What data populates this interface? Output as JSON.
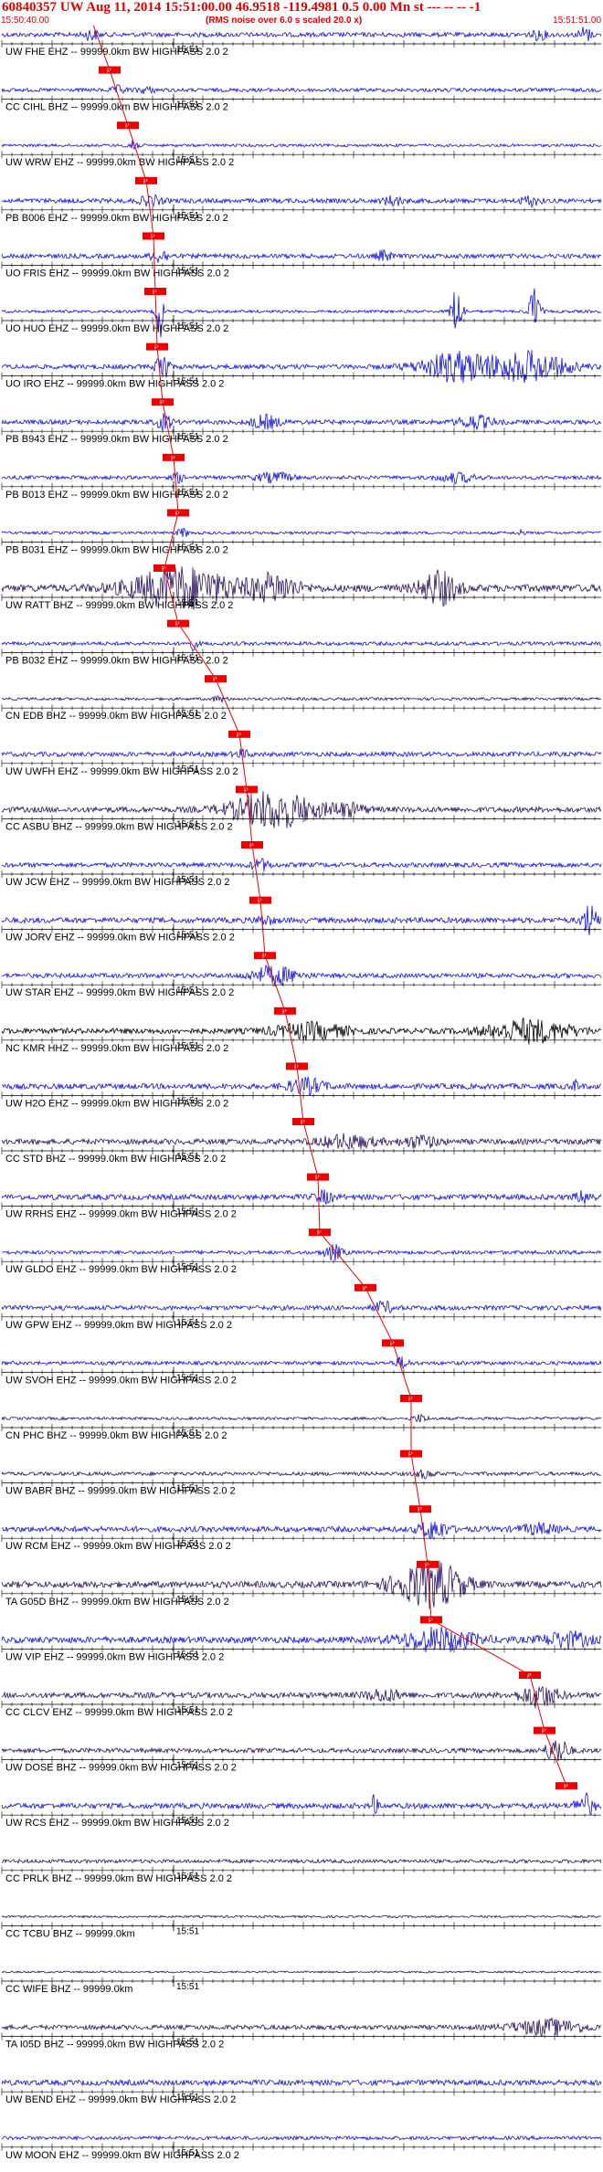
{
  "header": {
    "title": "60840357 UW Aug 11, 2014 15:51:00.00   46.9518 -119.4981  0.5 0.00 Mn st --- -- --  -1",
    "start_time": "15:50:40.00",
    "note": "(RMS noise over 6.0 s scaled 20.0 x)",
    "end_time": "15:51:51.00"
  },
  "tick_label": "15:51",
  "pick_label": "P",
  "colors": {
    "trace": "#1010e0",
    "trace_dark": "#2a1060",
    "trace_black": "#000000",
    "pick": "#ee0000",
    "accent": "#e00000"
  },
  "traces": [
    {
      "label": "UW FHE EHZ -- 99999.0km BW  HIGHPASS  2.0  2"
    },
    {
      "label": "CC CIHL BHZ -- 99999.0km BW  HIGHPASS  2.0  2"
    },
    {
      "label": "UW WRW EHZ -- 99999.0km BW  HIGHPASS  2.0  2"
    },
    {
      "label": "PB B006 EHZ -- 99999.0km BW  HIGHPASS  2.0  2"
    },
    {
      "label": "UO FRIS EHZ -- 99999.0km BW  HIGHPASS  2.0  2"
    },
    {
      "label": "UO HUO EHZ -- 99999.0km BW  HIGHPASS  2.0  2"
    },
    {
      "label": "UO IRO EHZ -- 99999.0km BW  HIGHPASS  2.0  2"
    },
    {
      "label": "PB B943 EHZ -- 99999.0km BW  HIGHPASS  2.0  2"
    },
    {
      "label": "PB B013 EHZ -- 99999.0km BW  HIGHPASS  2.0  2"
    },
    {
      "label": "PB B031 EHZ -- 99999.0km BW  HIGHPASS  2.0  2"
    },
    {
      "label": "UW RATT BHZ -- 99999.0km BW  HIGHPASS  2.0  2"
    },
    {
      "label": "PB B032 EHZ -- 99999.0km BW  HIGHPASS  2.0  2"
    },
    {
      "label": "CN EDB BHZ -- 99999.0km BW  HIGHPASS  2.0  2"
    },
    {
      "label": "UW UWFH EHZ -- 99999.0km BW  HIGHPASS  2.0  2"
    },
    {
      "label": "CC ASBU BHZ -- 99999.0km BW  HIGHPASS  2.0  2"
    },
    {
      "label": "UW JCW EHZ -- 99999.0km BW  HIGHPASS  2.0  2"
    },
    {
      "label": "UW JORV EHZ -- 99999.0km BW  HIGHPASS  2.0  2"
    },
    {
      "label": "UW STAR EHZ -- 99999.0km BW  HIGHPASS  2.0  2"
    },
    {
      "label": "NC KMR HHZ -- 99999.0km BW  HIGHPASS  2.0  2"
    },
    {
      "label": "UW H2O EHZ -- 99999.0km BW  HIGHPASS  2.0  2"
    },
    {
      "label": "CC STD BHZ -- 99999.0km BW  HIGHPASS  2.0  2"
    },
    {
      "label": "UW RRHS EHZ -- 99999.0km BW  HIGHPASS  2.0  2"
    },
    {
      "label": "UW GLDO EHZ -- 99999.0km BW  HIGHPASS  2.0  2"
    },
    {
      "label": "UW GPW EHZ -- 99999.0km BW  HIGHPASS  2.0  2"
    },
    {
      "label": "UW SVOH EHZ -- 99999.0km BW  HIGHPASS  2.0  2"
    },
    {
      "label": "CN PHC BHZ -- 99999.0km BW  HIGHPASS  2.0  2"
    },
    {
      "label": "UW BABR BHZ -- 99999.0km BW  HIGHPASS  2.0  2"
    },
    {
      "label": "UW RCM EHZ -- 99999.0km BW  HIGHPASS  2.0  2"
    },
    {
      "label": "TA G05D BHZ -- 99999.0km BW  HIGHPASS  2.0  2"
    },
    {
      "label": "UW VIP EHZ -- 99999.0km BW  HIGHPASS  2.0  2"
    },
    {
      "label": "CC CLCV EHZ -- 99999.0km BW  HIGHPASS  2.0  2"
    },
    {
      "label": "UW DOSE BHZ -- 99999.0km BW  HIGHPASS  2.0  2"
    },
    {
      "label": "UW RCS EHZ -- 99999.0km BW  HIGHPASS  2.0  2"
    },
    {
      "label": "CC PRLK BHZ -- 99999.0km BW  HIGHPASS  2.0  2"
    },
    {
      "label": "CC TCBU BHZ -- 99999.0km"
    },
    {
      "label": "CC WIFE BHZ -- 99999.0km"
    },
    {
      "label": "TA I05D BHZ -- 99999.0km BW  HIGHPASS  2.0  2"
    },
    {
      "label": "UW BEND EHZ -- 99999.0km BW  HIGHPASS  2.0  2"
    },
    {
      "label": "UW MOON EHZ -- 99999.0km BW  HIGHPASS  2.0  2"
    }
  ]
}
